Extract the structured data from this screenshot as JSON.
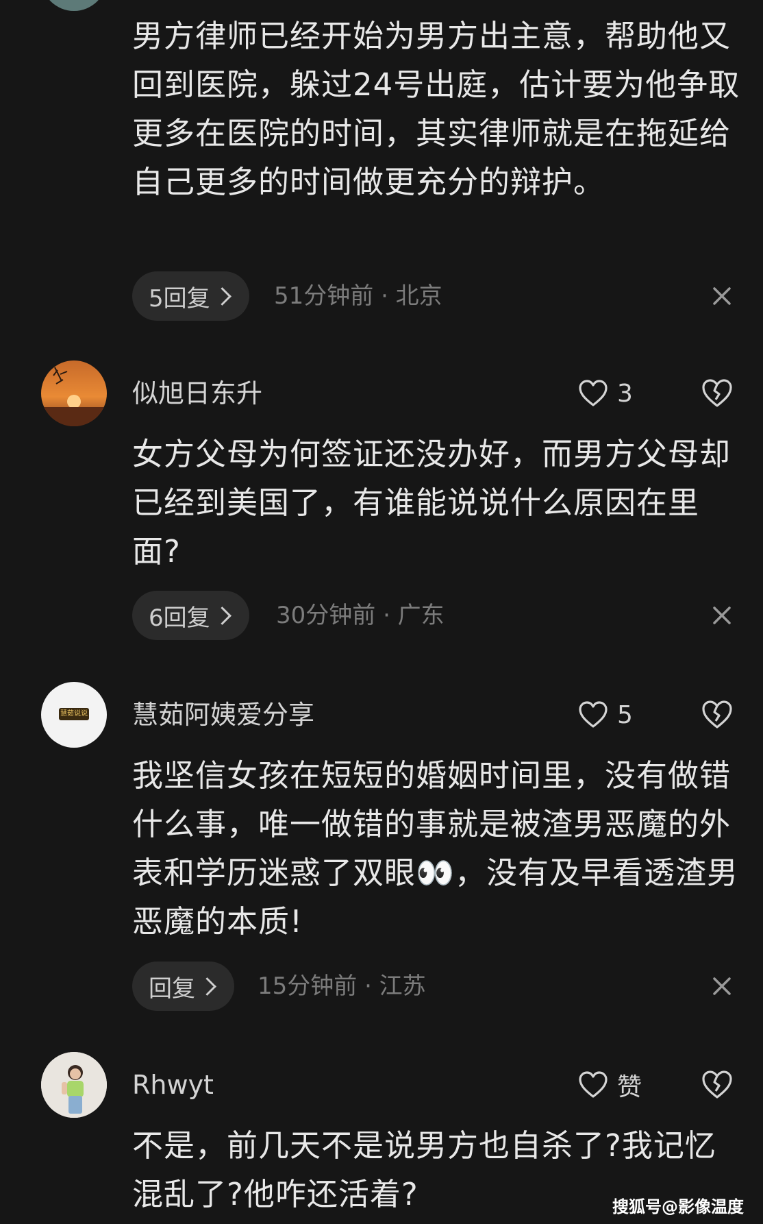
{
  "comments": [
    {
      "body": "男方律师已经开始为男方出主意，帮助他又回到医院，躲过24号出庭，估计要为他争取更多在医院的时间，其实律师就是在拖延给自己更多的时间做更充分的辩护。",
      "reply_label": "5回复",
      "meta": "51分钟前 · 北京"
    },
    {
      "username": "似旭日东升",
      "likes": "3",
      "body": "女方父母为何签证还没办好，而男方父母却已经到美国了，有谁能说说什么原因在里面?",
      "reply_label": "6回复",
      "meta": "30分钟前 · 广东"
    },
    {
      "username": "慧茹阿姨爱分享",
      "likes": "5",
      "avatar_text": "慧茹说说",
      "body": "我坚信女孩在短短的婚姻时间里，没有做错什么事，唯一做错的事就是被渣男恶魔的外表和学历迷惑了双眼👀，没有及早看透渣男恶魔的本质!",
      "reply_label": "回复",
      "meta": "15分钟前 · 江苏"
    },
    {
      "username": "Rhwyt",
      "likes": "赞",
      "body": "不是，前几天不是说男方也自杀了?我记忆混乱了?他咋还活着?"
    }
  ],
  "watermark": "搜狐号@影像温度",
  "icons": {
    "like": "heart-icon",
    "dislike": "broken-heart-icon",
    "dismiss": "close-icon",
    "reply_arrow": "chevron-right-icon"
  }
}
